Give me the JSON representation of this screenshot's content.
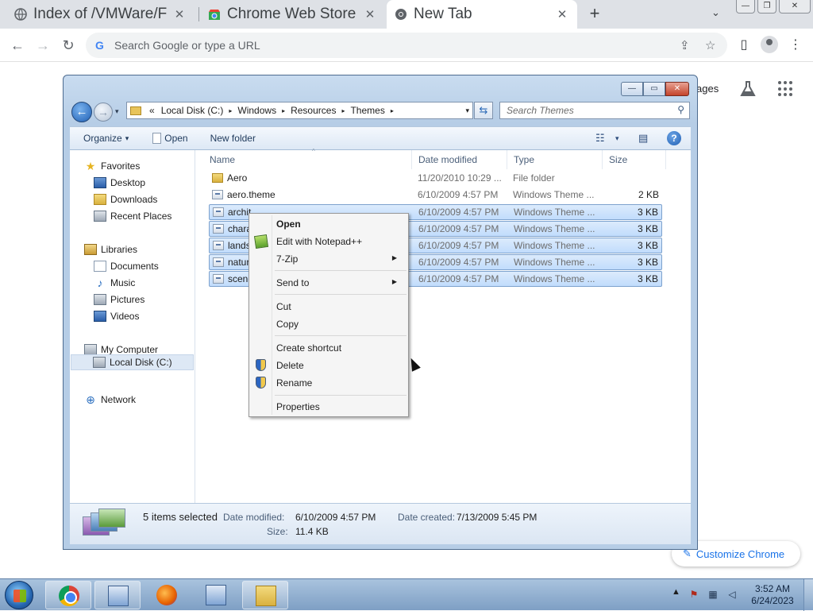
{
  "browser": {
    "tabs": [
      {
        "title": "Index of /VMWare/F",
        "close": "✕"
      },
      {
        "title": "Chrome Web Store",
        "close": "✕"
      },
      {
        "title": "New Tab",
        "close": "✕"
      }
    ],
    "new_tab": "+",
    "tab_search": "⌄",
    "window_buttons": {
      "minimize": "—",
      "restore": "❐",
      "close": "✕"
    },
    "nav": {
      "back": "←",
      "forward": "→",
      "reload": "↻"
    },
    "omnibox": {
      "placeholder": "Search Google or type a URL",
      "google_glyph": "G"
    },
    "icons": {
      "share": "⇪",
      "bookmark": "☆",
      "side_panel": "▯",
      "menu": "⋮"
    },
    "ntp": {
      "images_link": "ages",
      "labs_icon": "flask-icon",
      "customize_label": "Customize Chrome",
      "customize_icon": "✎"
    }
  },
  "explorer": {
    "caption": {
      "minimize": "—",
      "maximize": "▭",
      "close": "✕"
    },
    "nav": {
      "back": "←",
      "forward": "→",
      "history": "▾"
    },
    "address": {
      "prefix": "«",
      "crumbs": [
        "Local Disk (C:)",
        "Windows",
        "Resources",
        "Themes"
      ],
      "arrow": "▸",
      "dropdown": "▾"
    },
    "refresh": "⇆",
    "search_placeholder": "Search Themes",
    "search_icon": "⚲",
    "commands": {
      "organize": "Organize",
      "organize_caret": "▾",
      "open": "Open",
      "new_folder": "New folder",
      "views_icon": "☷",
      "views_caret": "▾",
      "preview_icon": "▤",
      "help": "?"
    },
    "navpane": {
      "favorites": "Favorites",
      "desktop": "Desktop",
      "downloads": "Downloads",
      "recent_places": "Recent Places",
      "libraries": "Libraries",
      "documents": "Documents",
      "music": "Music",
      "pictures": "Pictures",
      "videos": "Videos",
      "my_computer": "My Computer",
      "local_disk": "Local Disk (C:)",
      "network": "Network",
      "star_glyph": "★",
      "music_glyph": "♪",
      "network_glyph": "⊕"
    },
    "columns": {
      "name": "Name",
      "date": "Date modified",
      "type": "Type",
      "size": "Size",
      "sort_caret": "^"
    },
    "files": [
      {
        "name": "Aero",
        "date": "11/20/2010 10:29 ...",
        "type": "File folder",
        "size": "",
        "kind": "folder",
        "selected": false
      },
      {
        "name": "aero.theme",
        "date": "6/10/2009 4:57 PM",
        "type": "Windows Theme ...",
        "size": "2 KB",
        "kind": "theme",
        "selected": false
      },
      {
        "name": "archit",
        "date": "6/10/2009 4:57 PM",
        "type": "Windows Theme ...",
        "size": "3 KB",
        "kind": "theme",
        "selected": true
      },
      {
        "name": "chara",
        "date": "6/10/2009 4:57 PM",
        "type": "Windows Theme ...",
        "size": "3 KB",
        "kind": "theme",
        "selected": true
      },
      {
        "name": "lands",
        "date": "6/10/2009 4:57 PM",
        "type": "Windows Theme ...",
        "size": "3 KB",
        "kind": "theme",
        "selected": true
      },
      {
        "name": "natur",
        "date": "6/10/2009 4:57 PM",
        "type": "Windows Theme ...",
        "size": "3 KB",
        "kind": "theme",
        "selected": true
      },
      {
        "name": "scene",
        "date": "6/10/2009 4:57 PM",
        "type": "Windows Theme ...",
        "size": "3 KB",
        "kind": "theme",
        "selected": true
      }
    ],
    "details": {
      "selection": "5 items selected",
      "modified_label": "Date modified:",
      "modified_value": "6/10/2009 4:57 PM",
      "created_label": "Date created:",
      "created_value": "7/13/2009 5:45 PM",
      "size_label": "Size:",
      "size_value": "11.4 KB"
    }
  },
  "context_menu": {
    "open": "Open",
    "edit_notepad": "Edit with Notepad++",
    "seven_zip": "7-Zip",
    "send_to": "Send to",
    "cut": "Cut",
    "copy": "Copy",
    "create_shortcut": "Create shortcut",
    "delete": "Delete",
    "rename": "Rename",
    "properties": "Properties",
    "submenu_arrow": "▶"
  },
  "taskbar": {
    "tray_arrow": "▲",
    "tray_icons": {
      "flag": "⚑",
      "network": "▦",
      "volume": "◁"
    },
    "time": "3:52 AM",
    "date": "6/24/2023"
  }
}
